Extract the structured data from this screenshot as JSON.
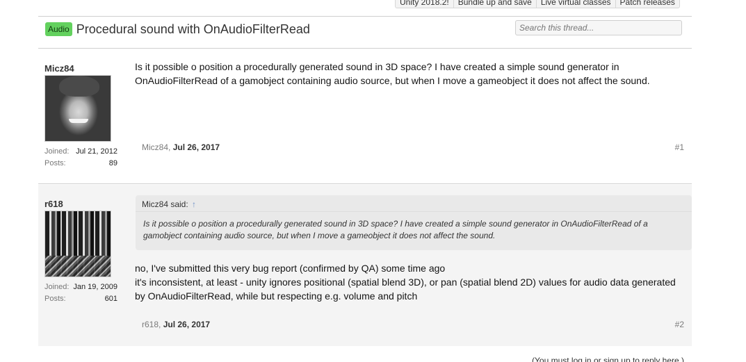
{
  "topnav": {
    "items": [
      "Unity 2018.2!",
      "Bundle up and save",
      "Live virtual classes",
      "Patch releases"
    ]
  },
  "thread": {
    "prefix": "Audio",
    "title": "Procedural sound with OnAudioFilterRead",
    "search_placeholder": "Search this thread..."
  },
  "posts": [
    {
      "username": "Micz84",
      "joined_label": "Joined:",
      "joined": "Jul 21, 2012",
      "posts_label": "Posts:",
      "post_count": "89",
      "message": "Is it possible o position a procedurally generated sound in 3D space? I have created a simple sound generator in OnAudioFilterRead of a gamobject containing audio source, but when I move a gameobject it does not affect the sound.",
      "meta_author": "Micz84,",
      "meta_date": "Jul 26, 2017",
      "number": "#1"
    },
    {
      "username": "r618",
      "joined_label": "Joined:",
      "joined": "Jan 19, 2009",
      "posts_label": "Posts:",
      "post_count": "601",
      "quote_author": "Micz84 said:",
      "quote_arrow": "↑",
      "quote_text": "Is it possible o position a procedurally generated sound in 3D space? I have created a simple sound generator in OnAudioFilterRead of a gamobject containing audio source, but when I move a gameobject it does not affect the sound.",
      "message_line1": "no, I've submitted this very bug report (confirmed by QA) some time ago",
      "message_line2": "it's inconsistent, at least - unity ignores positional (spatial blend 3D), or pan (spatial blend 2D) values for audio data generated by OnAudioFilterRead, while but respecting e.g. volume and pitch",
      "meta_author": "r618,",
      "meta_date": "Jul 26, 2017",
      "number": "#2"
    }
  ],
  "footer": {
    "note": "(You must log in or sign up to reply here.)"
  }
}
